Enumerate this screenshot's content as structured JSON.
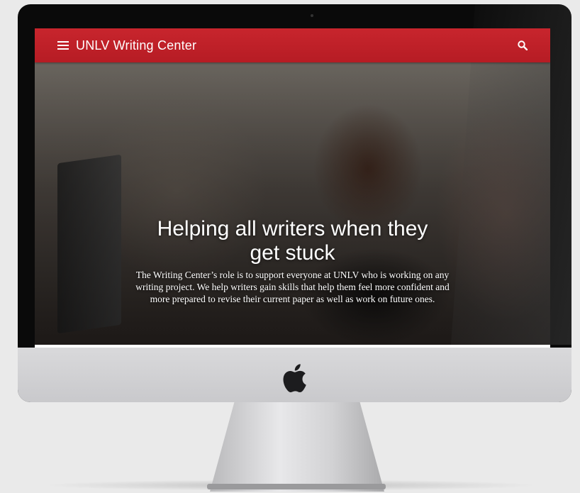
{
  "navbar": {
    "site_title": "UNLV Writing Center",
    "menu_icon": "hamburger-menu-icon",
    "search_icon": "search-icon",
    "accent_color": "#b61c24"
  },
  "hero": {
    "title": "Helping all writers when they get stuck",
    "description": "The Writing Center’s role is to support everyone at UNLV who is working on any writing project. We help writers gain skills that help them feel more confident and more prepared to revise their current paper as well as work on future ones."
  },
  "device": {
    "logo_icon": "apple-logo-icon"
  }
}
